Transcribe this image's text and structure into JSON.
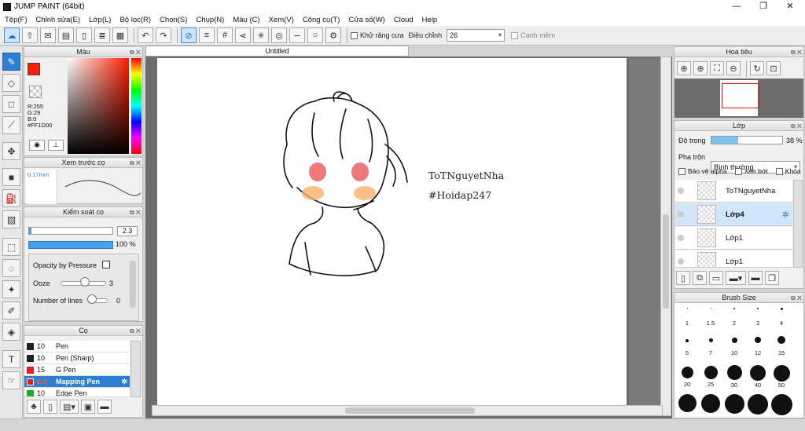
{
  "app": {
    "title": "JUMP PAINT (64bit)"
  },
  "window_controls": {
    "minimize": "—",
    "restore": "❐",
    "close": "✕"
  },
  "menu": [
    "Tệp(F)",
    "Chỉnh sửa(E)",
    "Lớp(L)",
    "Bộ lọc(R)",
    "Chọn(S)",
    "Chụp(N)",
    "Màu (C)",
    "Xem(V)",
    "Công cụ(T)",
    "Cửa số(W)",
    "Cloud",
    "Help"
  ],
  "toolbar": {
    "antialias_label": "Khử răng cưa",
    "correction_label": "Điều chỉnh",
    "correction_value": "26",
    "edge_label": "Cạnh mềm"
  },
  "color_panel": {
    "title": "Màu",
    "r": "R:255",
    "g": "G:29",
    "b": "B:0",
    "hex": "#FF1D00",
    "primary_color": "#FF1D00"
  },
  "preview_panel": {
    "title": "Xem trước cọ",
    "size": "0.17mm"
  },
  "brush_control": {
    "title": "Kiểm soát cọ",
    "size_value": "2.3",
    "opacity_value": "100 %",
    "opacity_pressure_label": "Opacity by Pressure",
    "ooze_label": "Ooze",
    "ooze_value": "3",
    "lines_label": "Number of lines",
    "lines_value": "0"
  },
  "brush_panel": {
    "title": "Cọ",
    "brushes": [
      {
        "size": "10",
        "name": "Pen",
        "color": "#222222"
      },
      {
        "size": "10",
        "name": "Pen (Sharp)",
        "color": "#222222"
      },
      {
        "size": "15",
        "name": "G Pen",
        "color": "#e02020"
      },
      {
        "size": "2.3",
        "name": "Mapping Pen",
        "color": "#e02020"
      },
      {
        "size": "10",
        "name": "Edge Pen",
        "color": "#22aa22"
      }
    ]
  },
  "document": {
    "tab": "Untitled"
  },
  "canvas_text": {
    "line1": "ToTNguyetNha",
    "line2": "#Hoidap247"
  },
  "navigator": {
    "title": "Hoa tiêu"
  },
  "layers_panel": {
    "title": "Lớp",
    "opacity_label": "Độ trong",
    "opacity_value": "38 %",
    "opacity_fraction": 0.38,
    "blend_label": "Pha trộn",
    "blend_value": "Bình thường",
    "protect_alpha": "Bảo vệ alpha",
    "clipping": "Xén bớt",
    "lock": "Khóa",
    "layers": [
      {
        "name": "ToTNguyetNha"
      },
      {
        "name": "Lớp4"
      },
      {
        "name": "Lớp1"
      },
      {
        "name": "Lớp1"
      }
    ]
  },
  "brush_size": {
    "title": "Brush Size",
    "rows": [
      [
        "1",
        "1.5",
        "2",
        "3",
        "4"
      ],
      [
        "5",
        "7",
        "10",
        "12",
        "15"
      ],
      [
        "20",
        "25",
        "30",
        "40",
        "50"
      ]
    ]
  }
}
